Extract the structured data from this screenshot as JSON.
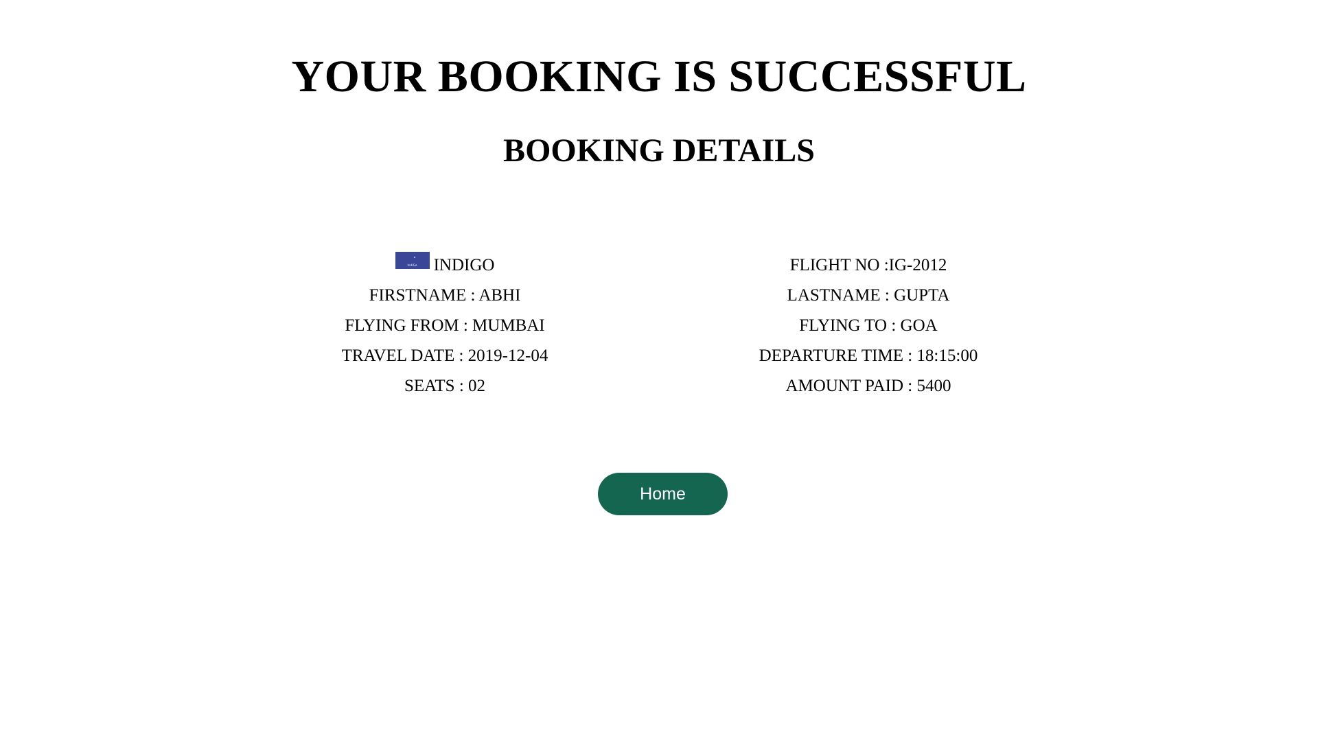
{
  "header": {
    "title": "YOUR BOOKING IS SUCCESSFUL",
    "subtitle": "BOOKING DETAILS"
  },
  "booking": {
    "airline": {
      "name": "INDIGO",
      "logo_text": "IndiGo",
      "logo_color": "#3a4799"
    },
    "flight_no": "FLIGHT NO :IG-2012",
    "firstname": "FIRSTNAME : ABHI",
    "lastname": "LASTNAME : GUPTA",
    "flying_from": "FLYING FROM : MUMBAI",
    "flying_to": "FLYING TO : GOA",
    "travel_date": "TRAVEL DATE : 2019-12-04",
    "departure_time": "DEPARTURE TIME : 18:15:00",
    "seats": "SEATS : 02",
    "amount_paid": "AMOUNT PAID : 5400"
  },
  "actions": {
    "home_label": "Home",
    "home_color": "#156650"
  }
}
